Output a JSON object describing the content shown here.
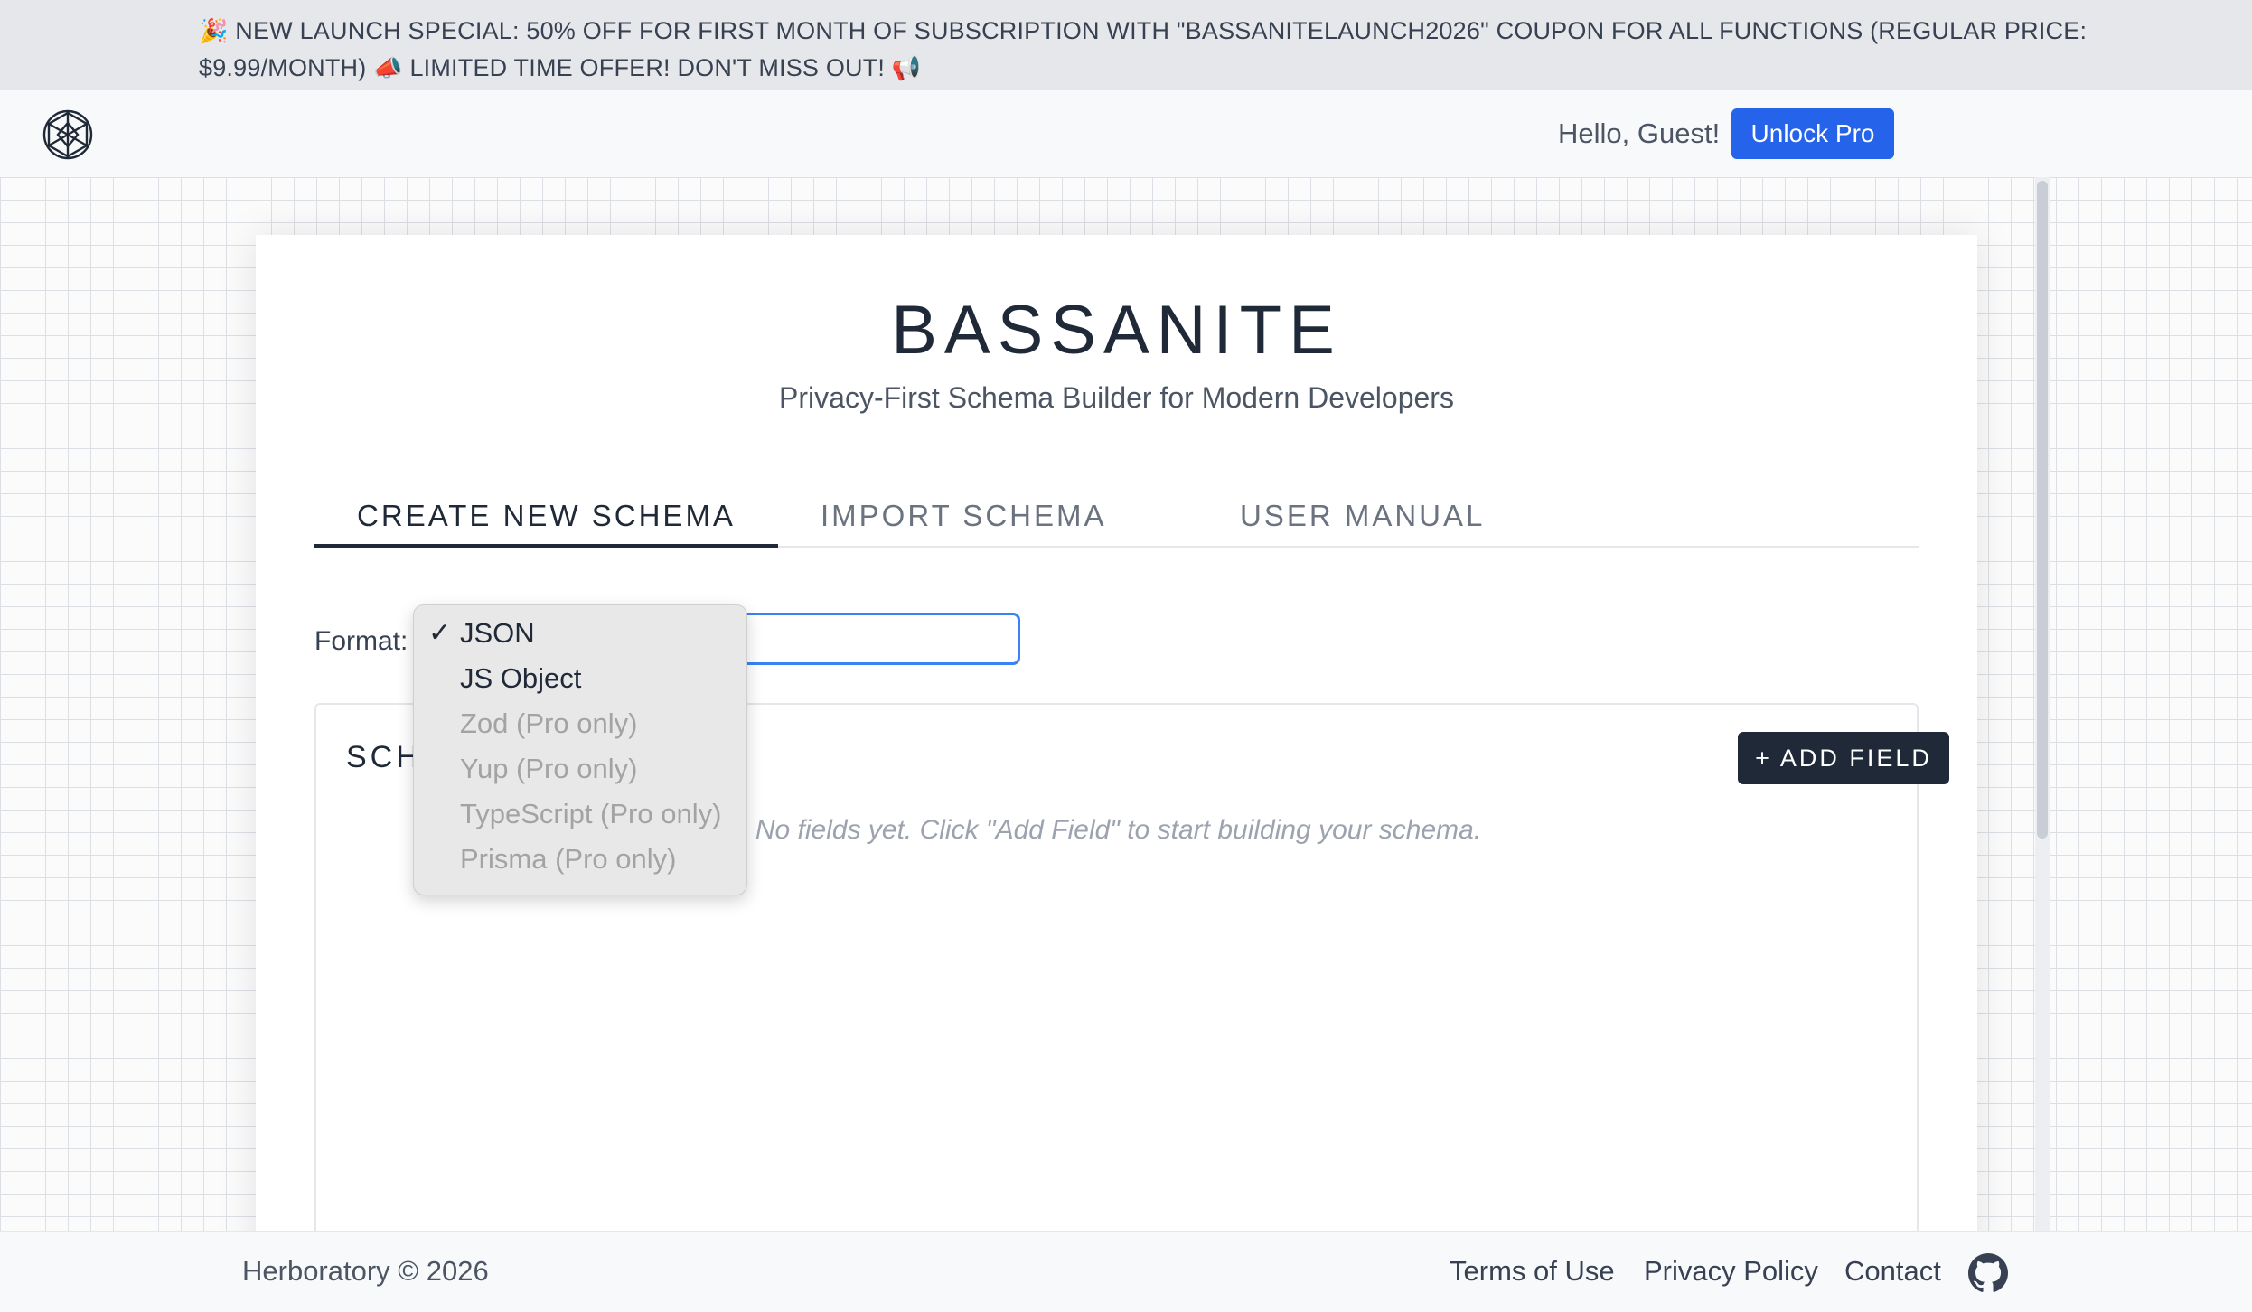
{
  "banner": {
    "emoji_start": "🎉",
    "text_main": "NEW LAUNCH SPECIAL: 50% OFF FOR FIRST MONTH OF SUBSCRIPTION WITH \"BASSANITELAUNCH2026\" COUPON FOR ALL FUNCTIONS   (REGULAR PRICE: $9.99/MONTH)",
    "emoji_mid": "📣",
    "text_tail": "LIMITED TIME OFFER! DON'T MISS OUT!",
    "emoji_end": "📢"
  },
  "header": {
    "logo_icon": "bassanite-logo-icon",
    "greeting": "Hello, Guest!",
    "unlock_label": "Unlock Pro",
    "accent_color": "#2563eb"
  },
  "main": {
    "title": "BASSANITE",
    "subtitle": "Privacy-First Schema Builder for Modern Developers",
    "tabs": [
      {
        "label": "CREATE NEW SCHEMA",
        "active": true
      },
      {
        "label": "IMPORT SCHEMA",
        "active": false
      },
      {
        "label": "USER MANUAL",
        "active": false
      }
    ],
    "format_label": "Format:",
    "format_selected": "JSON",
    "schema_title": "SCH",
    "add_field_label": "+ ADD FIELD",
    "empty_message": "No fields yet. Click \"Add Field\" to start building your schema."
  },
  "dropdown": {
    "options": [
      {
        "label": "JSON",
        "selected": true,
        "disabled": false
      },
      {
        "label": "JS Object",
        "selected": false,
        "disabled": false
      },
      {
        "label": "Zod (Pro only)",
        "selected": false,
        "disabled": true
      },
      {
        "label": "Yup (Pro only)",
        "selected": false,
        "disabled": true
      },
      {
        "label": "TypeScript (Pro only)",
        "selected": false,
        "disabled": true
      },
      {
        "label": "Prisma (Pro only)",
        "selected": false,
        "disabled": true
      }
    ],
    "check_glyph": "✓"
  },
  "footer": {
    "copyright": "Herboratory © 2026",
    "links": [
      "Terms of Use",
      "Privacy Policy",
      "Contact"
    ],
    "github_icon": "github-icon"
  }
}
